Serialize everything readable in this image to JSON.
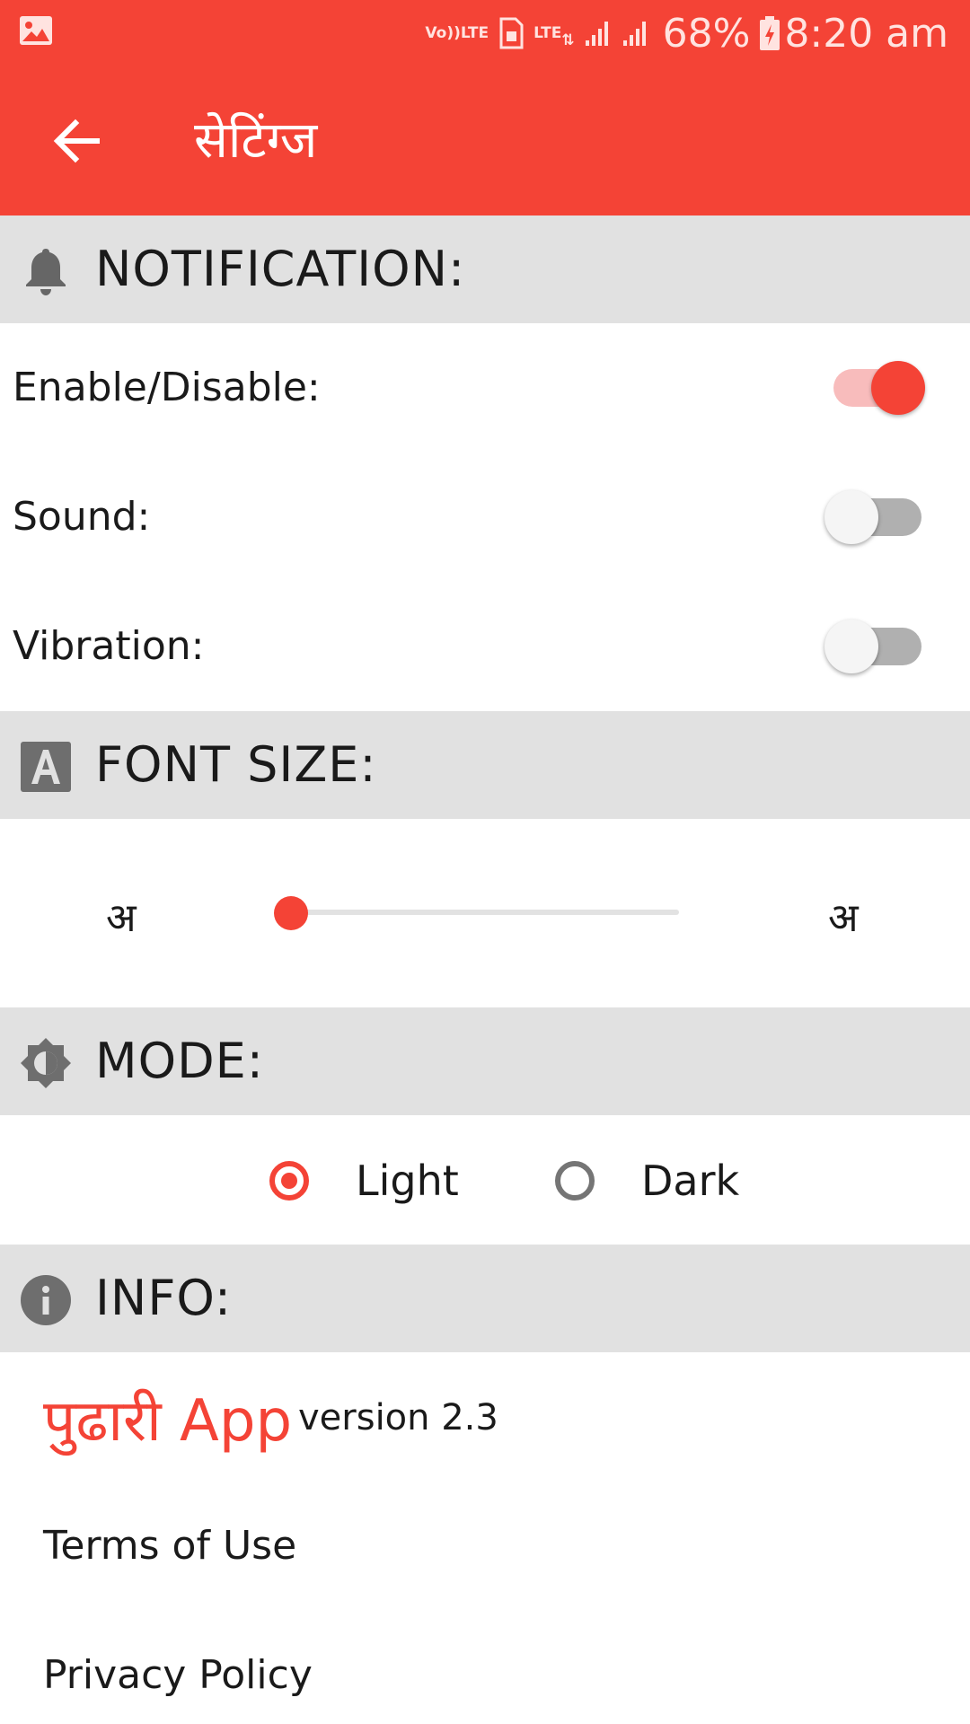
{
  "status_bar": {
    "volte": [
      "Vo))",
      "LTE"
    ],
    "network": "LTE",
    "battery": "68%",
    "time": "8:20 am",
    "icons": [
      "image-icon",
      "volte-icon",
      "sim-icon",
      "lte-data-icon",
      "signal-icon",
      "signal-icon",
      "battery-charging-icon"
    ]
  },
  "app_bar": {
    "title": "सेटिंग्ज",
    "back_icon": "arrow-back-icon"
  },
  "notification": {
    "title": "NOTIFICATION:",
    "icon": "bell-icon",
    "rows": [
      {
        "label": "Enable/Disable:",
        "on": true
      },
      {
        "label": "Sound:",
        "on": false
      },
      {
        "label": "Vibration:",
        "on": false
      }
    ]
  },
  "font_size": {
    "title": "FONT SIZE:",
    "icon": "font-a-icon",
    "small_label": "अ",
    "large_label": "अ",
    "level": 0
  },
  "mode": {
    "title": "MODE:",
    "icon": "brightness-icon",
    "options": [
      "Light",
      "Dark"
    ],
    "selected": "Light"
  },
  "info": {
    "title": "INFO:",
    "icon": "info-icon",
    "app_name": "पुढारी App",
    "version": "version 2.3",
    "links": [
      "Terms of Use",
      "Privacy Policy"
    ]
  },
  "colors": {
    "accent": "#f44336",
    "section_bg": "#e1e1e1"
  }
}
